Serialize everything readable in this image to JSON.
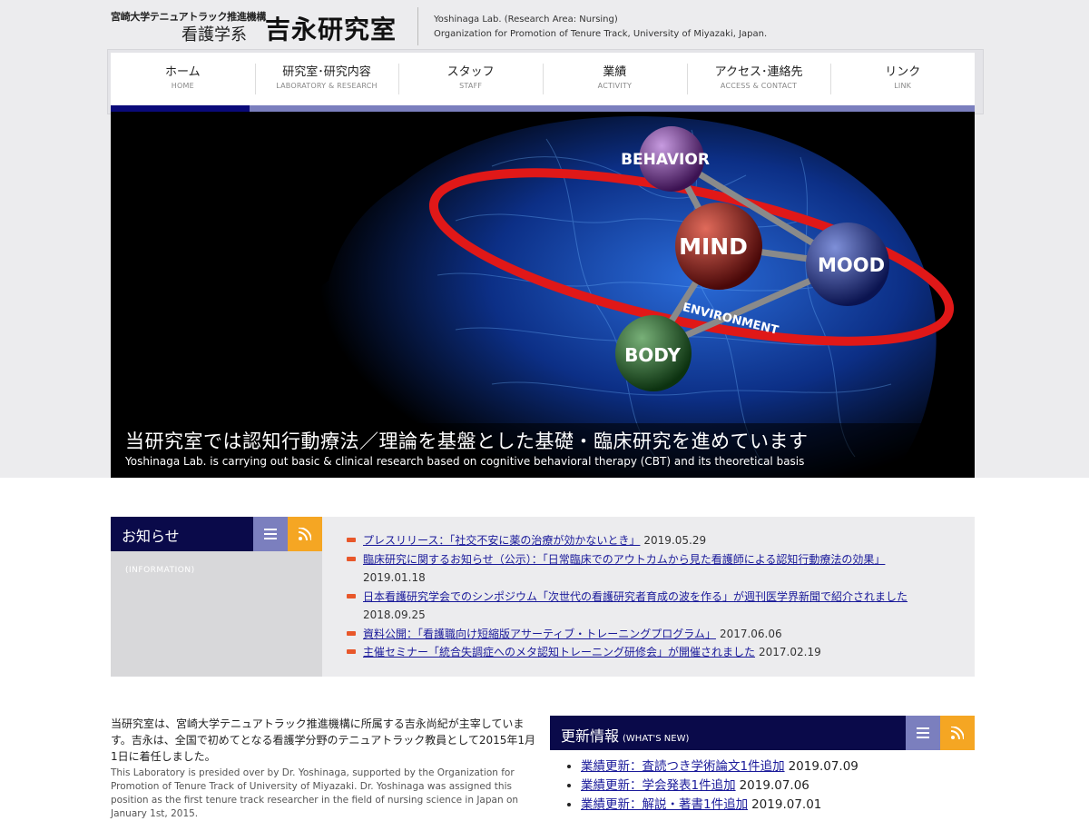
{
  "header": {
    "org_small": "宮崎大学テニュアトラック推進機構",
    "dept": "看護学系",
    "lab_name": "吉永研究室",
    "en_line1": "Yoshinaga Lab. (Research Area: Nursing)",
    "en_line2": "Organization for Promotion of Tenure Track, University of Miyazaki, Japan."
  },
  "nav": {
    "items": [
      {
        "jp": "ホーム",
        "en": "HOME"
      },
      {
        "jp": "研究室･研究内容",
        "en": "LABORATORY & RESEARCH"
      },
      {
        "jp": "スタッフ",
        "en": "STAFF"
      },
      {
        "jp": "業績",
        "en": "ACTIVITY"
      },
      {
        "jp": "アクセス･連絡先",
        "en": "ACCESS & CONTACT"
      },
      {
        "jp": "リンク",
        "en": "LINK"
      }
    ],
    "active_index": 0
  },
  "hero": {
    "labels": [
      "BEHAVIOR",
      "MIND",
      "MOOD",
      "BODY",
      "ENVIRONMENT"
    ],
    "title": "当研究室では認知行動療法／理論を基盤とした基礎・臨床研究を進めています",
    "subtitle": "Yoshinaga Lab. is carrying out basic & clinical research based on cognitive behavioral therapy (CBT) and its theoretical basis"
  },
  "info": {
    "heading": "お知らせ",
    "label": "(INFORMATION)",
    "items": [
      {
        "text": "プレスリリース：「社交不安に薬の治療が効かないとき」",
        "date": "2019.05.29"
      },
      {
        "text": "臨床研究に関するお知らせ（公示）：「日常臨床でのアウトカムから見た看護師による認知行動療法の効果」",
        "date": "2019.01.18"
      },
      {
        "text": "日本看護研究学会でのシンポジウム「次世代の看護研究者育成の波を作る」が週刊医学界新聞で紹介されました",
        "date": "2018.09.25"
      },
      {
        "text": "資料公開：「看護職向け短縮版アサーティブ・トレーニングプログラム」",
        "date": "2017.06.06"
      },
      {
        "text": "主催セミナー「統合失調症へのメタ認知トレーニング研修会」が開催されました",
        "date": "2017.02.19"
      }
    ]
  },
  "intro": {
    "jp": "当研究室は、宮崎大学テニュアトラック推進機構に所属する吉永尚紀が主宰しています。吉永は、全国で初めてとなる看護学分野のテニュアトラック教員として2015年1月1日に着任しました。",
    "en": "This Laboratory is presided over by Dr. Yoshinaga, supported by the Organization for Promotion of Tenure Track of University of Miyazaki. Dr. Yoshinaga was assigned this position as the first tenure track researcher in the field of nursing science in Japan on January 1st, 2015."
  },
  "whatsnew": {
    "heading": "更新情報",
    "sub": "(WHAT'S NEW)",
    "items": [
      {
        "text": "業績更新：査読つき学術論文1件追加",
        "date": "2019.07.09"
      },
      {
        "text": "業績更新：学会発表1件追加",
        "date": "2019.07.06"
      },
      {
        "text": "業績更新：解説・著書1件追加",
        "date": "2019.07.01"
      }
    ]
  },
  "colors": {
    "navy": "#0a0a4a",
    "accent_purple": "#7b7fbe",
    "accent_orange": "#f5a623",
    "link": "#1a1a9a",
    "bullet": "#e8572a"
  }
}
